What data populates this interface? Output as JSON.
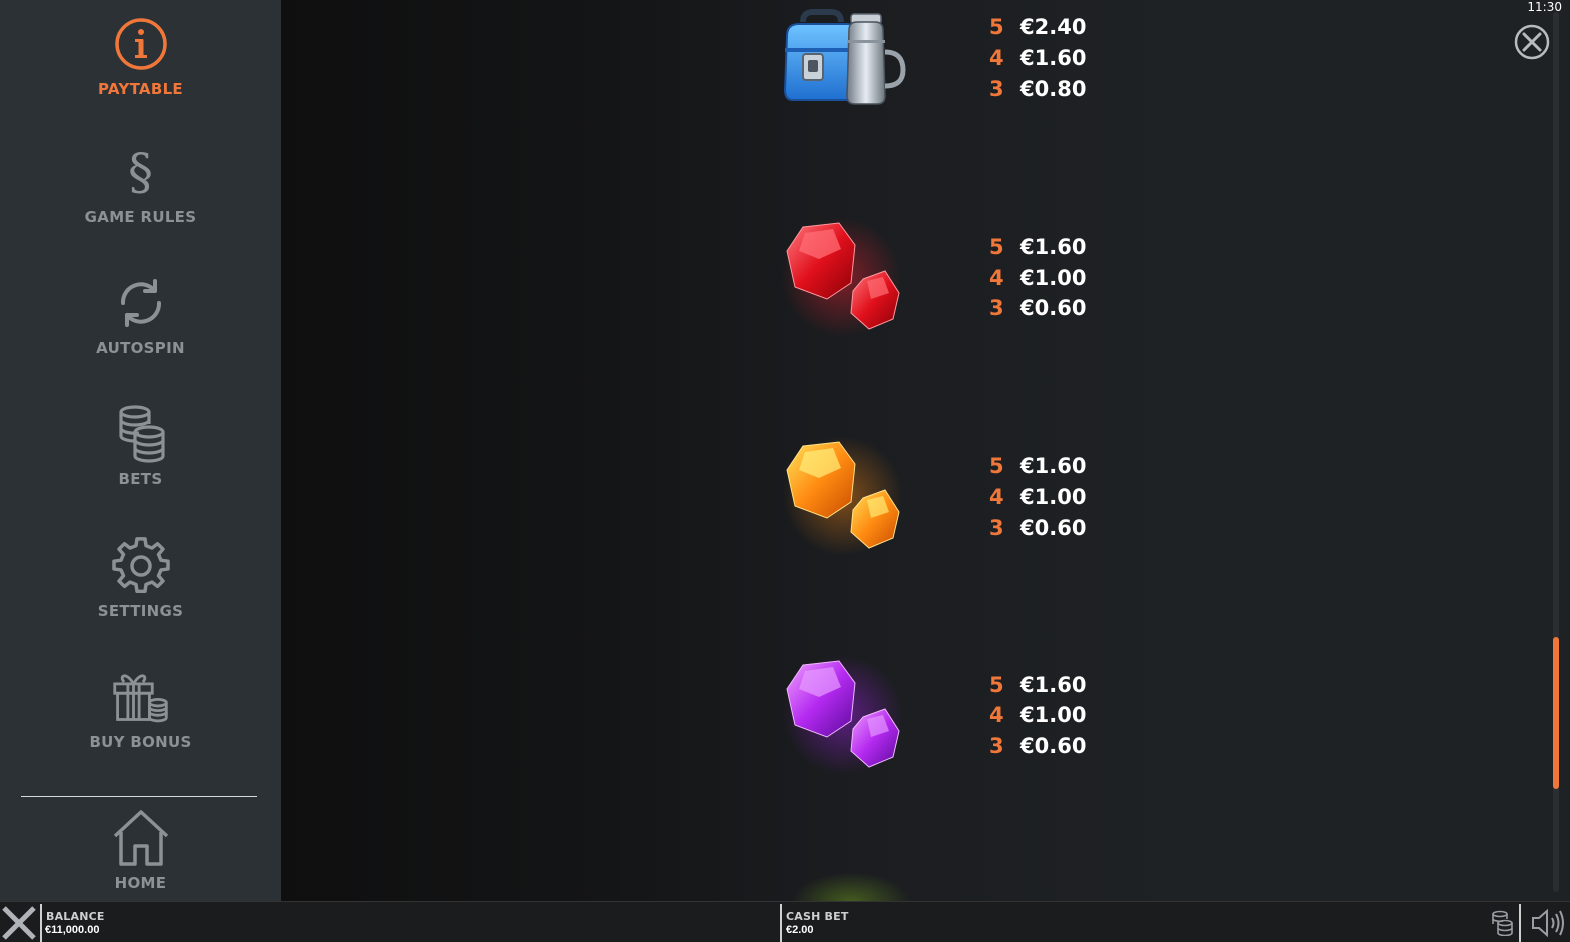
{
  "sidebar": {
    "items": [
      {
        "label": "PAYTABLE",
        "icon": "info-icon",
        "active": true
      },
      {
        "label": "GAME RULES",
        "icon": "section-icon"
      },
      {
        "label": "AUTOSPIN",
        "icon": "refresh-icon"
      },
      {
        "label": "BETS",
        "icon": "coins-stack-icon"
      },
      {
        "label": "SETTINGS",
        "icon": "gear-icon"
      },
      {
        "label": "BUY BONUS",
        "icon": "gift-icon"
      },
      {
        "label": "HOME",
        "icon": "home-icon"
      }
    ],
    "section_glyph": "§"
  },
  "paytable": {
    "rows": [
      {
        "symbol": "lunchbox-thermos",
        "lines": [
          {
            "count": "5",
            "amount": "€2.40"
          },
          {
            "count": "4",
            "amount": "€1.60"
          },
          {
            "count": "3",
            "amount": "€0.80"
          }
        ]
      },
      {
        "symbol": "red-gems",
        "lines": [
          {
            "count": "5",
            "amount": "€1.60"
          },
          {
            "count": "4",
            "amount": "€1.00"
          },
          {
            "count": "3",
            "amount": "€0.60"
          }
        ]
      },
      {
        "symbol": "orange-gems",
        "lines": [
          {
            "count": "5",
            "amount": "€1.60"
          },
          {
            "count": "4",
            "amount": "€1.00"
          },
          {
            "count": "3",
            "amount": "€0.60"
          }
        ]
      },
      {
        "symbol": "purple-gems",
        "lines": [
          {
            "count": "5",
            "amount": "€1.60"
          },
          {
            "count": "4",
            "amount": "€1.00"
          },
          {
            "count": "3",
            "amount": "€0.60"
          }
        ]
      }
    ]
  },
  "status": {
    "clock": "11:30"
  },
  "bottom_bar": {
    "balance_label": "BALANCE",
    "balance_value": "€11,000.00",
    "cash_bet_label": "CASH BET",
    "cash_bet_value": "€2.00"
  },
  "colors": {
    "accent": "#f0773a",
    "sidebar": "#2c3136",
    "muted": "#8c9196"
  }
}
